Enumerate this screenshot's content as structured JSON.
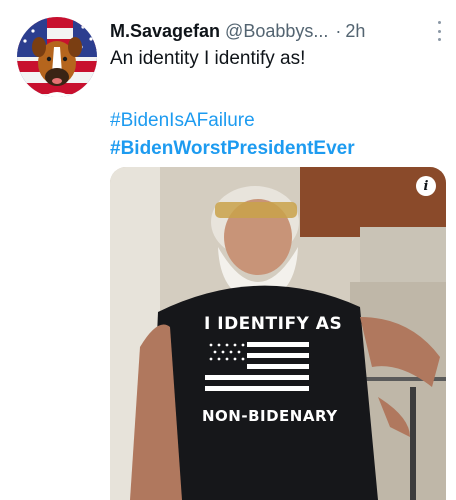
{
  "tweet": {
    "author_name": "M.Savagefan",
    "handle": "@Boabbys...",
    "separator": "·",
    "time": "2h",
    "text": "An identity I identify as!",
    "hashtags": [
      "#BidenIsAFailure",
      "#BidenWorstPresidentEver"
    ]
  },
  "media": {
    "info_badge": "i",
    "shirt_line1": "I IDENTIFY AS",
    "shirt_line2": "NON-BIDENARY"
  },
  "icons": {
    "more": "more-options-icon",
    "info": "info-icon"
  },
  "colors": {
    "hashtag": "#1d9bf0",
    "text": "#0f1419",
    "secondary": "#536471"
  }
}
